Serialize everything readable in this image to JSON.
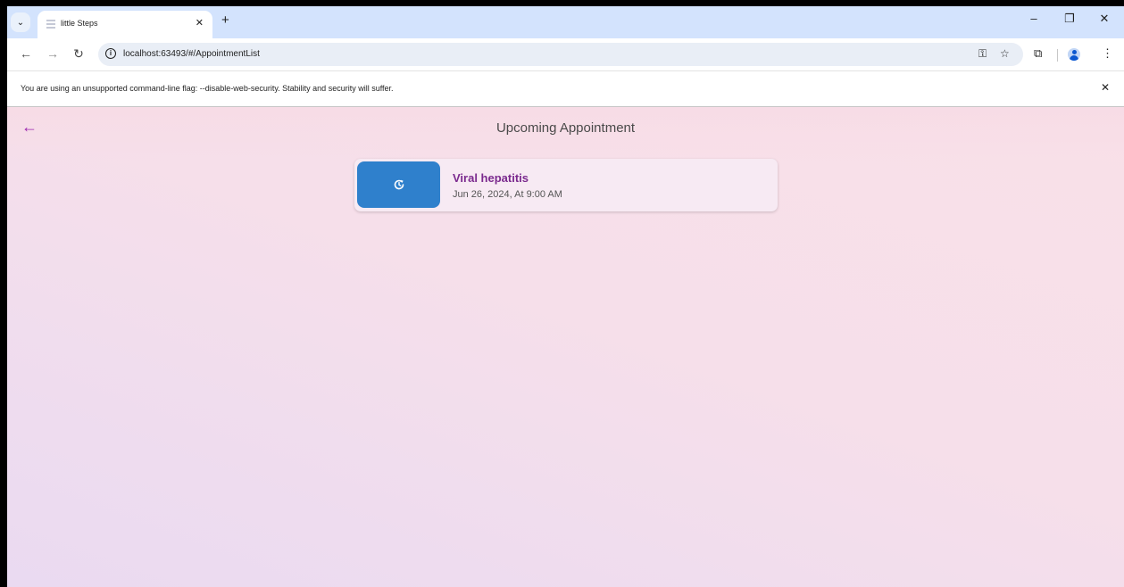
{
  "browser": {
    "tab": {
      "title": "little Steps",
      "close": "✕"
    },
    "new_tab": "+",
    "tab_list": "⌄",
    "window_controls": {
      "minimize": "–",
      "restore": "❐",
      "close": "✕"
    },
    "nav": {
      "back": "←",
      "forward": "→",
      "reload": "↻"
    },
    "url": "localhost:63493/#/AppointmentList",
    "omnibox_icons": [
      "password-key-icon",
      "bookmark-star-icon"
    ],
    "toolbar_icons": [
      "extensions-icon",
      "profile-avatar-icon",
      "menu-icon"
    ],
    "glyphs": {
      "key": "⚿",
      "star": "☆",
      "extensions": "⧉",
      "menu": "⋮"
    }
  },
  "infobar": {
    "message": "You are using an unsupported command-line flag: --disable-web-security. Stability and security will suffer.",
    "close": "✕"
  },
  "page": {
    "back": "←",
    "title": "Upcoming Appointment",
    "appointments": [
      {
        "title": "Viral hepatitis",
        "datetime": "Jun 26, 2024,  At 9:00 AM",
        "icon": "schedule-update-icon"
      }
    ]
  },
  "colors": {
    "accent": "#9c27b0",
    "card_title": "#7b2a8e",
    "badge": "#2f80cc"
  }
}
